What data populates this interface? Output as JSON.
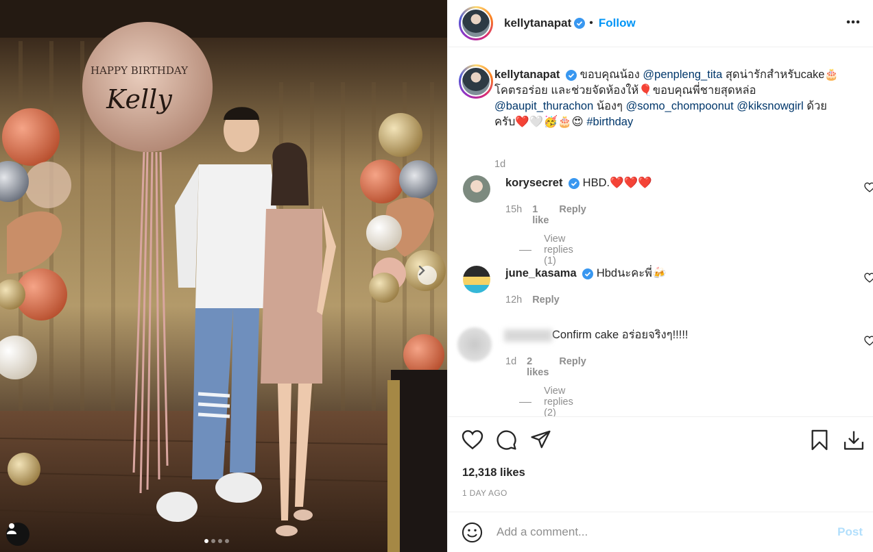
{
  "header": {
    "username": "kellytanapat",
    "follow_label": "Follow",
    "separator": "•"
  },
  "caption": {
    "username": "kellytanapat",
    "text_1": "ขอบคุณน้อง ",
    "mention_1": "@penpleng_tita",
    "text_2": " สุดน่ารักสำหรับcake🎂",
    "text_3": "โคตรอร่อย และช่วยจัดห้องให้🎈ขอบคุณพี่ชายสุดหล่อ",
    "mention_2": "@baupit_thurachon",
    "text_4": " น้องๆ ",
    "mention_3": "@somo_chompoonut",
    "text_5": " ",
    "mention_4": "@kiksnowgirl",
    "text_6": " ด้วย",
    "text_7": "ครับ❤️🤍🥳🎂😍 ",
    "hashtag": "#birthday",
    "time": "1d"
  },
  "comments": [
    {
      "username": "korysecret",
      "text": "HBD.❤️❤️❤️",
      "time": "15h",
      "likes": "1 like",
      "reply": "Reply",
      "view_replies": "View replies (1)"
    },
    {
      "username": "june_kasama",
      "text": "Hbdนะคะพี่🍻",
      "time": "12h",
      "likes": "",
      "reply": "Reply",
      "view_replies": ""
    },
    {
      "username": "",
      "text": "Confirm cake อร่อยจริงๆ!!!!!",
      "time": "1d",
      "likes": "2 likes",
      "reply": "Reply",
      "view_replies": "View replies (2)"
    }
  ],
  "stats": {
    "likes": "12,318 likes",
    "ago": "1 DAY AGO"
  },
  "add_comment": {
    "placeholder": "Add a comment...",
    "post_label": "Post"
  },
  "photo": {
    "balloon_line_1": "HAPPY BIRTHDAY",
    "balloon_line_2": "Kelly",
    "carousel_count": 4,
    "carousel_index": 0
  },
  "colors": {
    "accent": "#0095f6",
    "verified": "#3897f0",
    "heart": "#ed4956",
    "muted": "#8e8e8e"
  },
  "icons": [
    "verified-icon",
    "more-icon",
    "heart-icon",
    "comment-icon",
    "share-icon",
    "save-icon",
    "download-icon",
    "emoji-icon",
    "next-arrow-icon",
    "user-tag-icon"
  ]
}
